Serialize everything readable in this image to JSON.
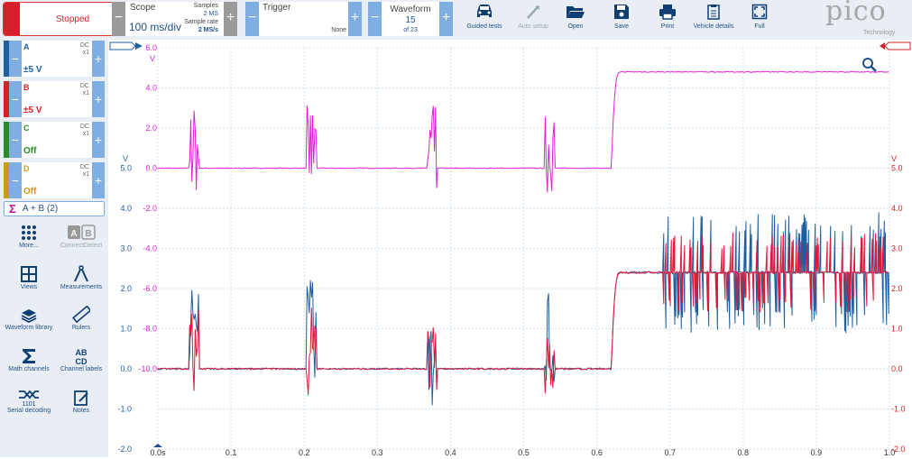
{
  "toolbar": {
    "run_state": "Stopped",
    "scope": {
      "title": "Scope",
      "timebase": "100 ms/div",
      "samples_label": "Samples",
      "samples_value": "2 MS",
      "rate_label": "Sample rate",
      "rate_value": "2 MS/s"
    },
    "trigger": {
      "title": "Trigger",
      "mode": "None"
    },
    "waveform": {
      "title": "Waveform",
      "current": "15",
      "of_total": "of 23"
    },
    "buttons": [
      {
        "label": "Guided tests",
        "icon": "car-icon"
      },
      {
        "label": "Auto setup",
        "icon": "wand-icon",
        "disabled": true
      },
      {
        "label": "Open",
        "icon": "folder-icon"
      },
      {
        "label": "Save",
        "icon": "save-icon"
      },
      {
        "label": "Print",
        "icon": "printer-icon"
      },
      {
        "label": "Vehicle details",
        "icon": "clipboard-icon"
      },
      {
        "label": "Full",
        "icon": "fullscreen-icon"
      }
    ],
    "logo": {
      "brand": "pico",
      "sub": "Technology"
    }
  },
  "channels": [
    {
      "name": "A",
      "coupling": "DC",
      "probe": "x1",
      "range": "±5 V",
      "color": "#1f5fa0"
    },
    {
      "name": "B",
      "coupling": "DC",
      "probe": "x1",
      "range": "±5 V",
      "color": "#d4202a"
    },
    {
      "name": "C",
      "coupling": "DC",
      "probe": "x1",
      "range": "Off",
      "color": "#2a8a2a"
    },
    {
      "name": "D",
      "coupling": "DC",
      "probe": "x1",
      "range": "Off",
      "color": "#c89a1e"
    }
  ],
  "math_channel": {
    "label": "A + B (2)"
  },
  "tools": [
    {
      "label": "More...",
      "icon": "grid-dots-icon"
    },
    {
      "label": "ConnectDetect",
      "icon": "connect-detect-icon",
      "disabled": true
    },
    {
      "label": "Views",
      "icon": "views-icon"
    },
    {
      "label": "Measurements",
      "icon": "compass-icon"
    },
    {
      "label": "Waveform library",
      "icon": "library-icon"
    },
    {
      "label": "Rulers",
      "icon": "ruler-icon"
    },
    {
      "label": "Math channels",
      "icon": "sigma-icon"
    },
    {
      "label": "Channel labels",
      "icon": "abcd-icon"
    },
    {
      "label": "Serial decoding",
      "icon": "serial-icon"
    },
    {
      "label": "Notes",
      "icon": "notes-icon"
    }
  ],
  "colors": {
    "math": "#e020d8",
    "channel_a": "#1f5fa0",
    "channel_b": "#e0183a",
    "grid": "#cfe0ee"
  },
  "chart_data": [
    {
      "type": "line",
      "title": "",
      "x_range": [
        0.0,
        1.0
      ],
      "x_ticks": [
        "0.0s",
        "0.1",
        "0.2",
        "0.3",
        "0.4",
        "0.5",
        "0.6",
        "0.7",
        "0.8",
        "0.9",
        "1.0"
      ],
      "left_axis_math": {
        "unit": "V",
        "ticks": [
          "6.0",
          "4.0",
          "2.0",
          "0.0",
          "-2.0",
          "-4.0",
          "-6.0",
          "-8.0",
          "-10.0"
        ]
      },
      "left_axis_ab": {
        "unit": "V",
        "ticks": [
          "5.0",
          "4.0",
          "3.0",
          "2.0",
          "1.0",
          "0.0",
          "-1.0",
          "-2.0"
        ]
      },
      "right_axis": {
        "unit": "V",
        "ticks": [
          "5.0",
          "4.0",
          "3.0",
          "2.0",
          "1.0",
          "0.0",
          "-1.0",
          "-2.0"
        ]
      },
      "series": [
        {
          "name": "A + B (2)",
          "color": "#e020d8",
          "baseline": 0.0,
          "bursts_at": [
            0.05,
            0.21,
            0.375,
            0.535
          ],
          "step_at": 0.62,
          "level_after_step": 4.8
        },
        {
          "name": "A",
          "color": "#1f5fa0",
          "baseline": 0.0,
          "bursts_at": [
            0.05,
            0.21,
            0.375,
            0.535
          ],
          "step_at": 0.62,
          "level_after_step": 2.4,
          "pulsing_from": 0.69
        },
        {
          "name": "B",
          "color": "#e0183a",
          "baseline": 0.0,
          "bursts_at": [
            0.05,
            0.21,
            0.375,
            0.535
          ],
          "step_at": 0.62,
          "level_after_step": 2.4,
          "pulsing_from": 0.69
        }
      ]
    }
  ]
}
